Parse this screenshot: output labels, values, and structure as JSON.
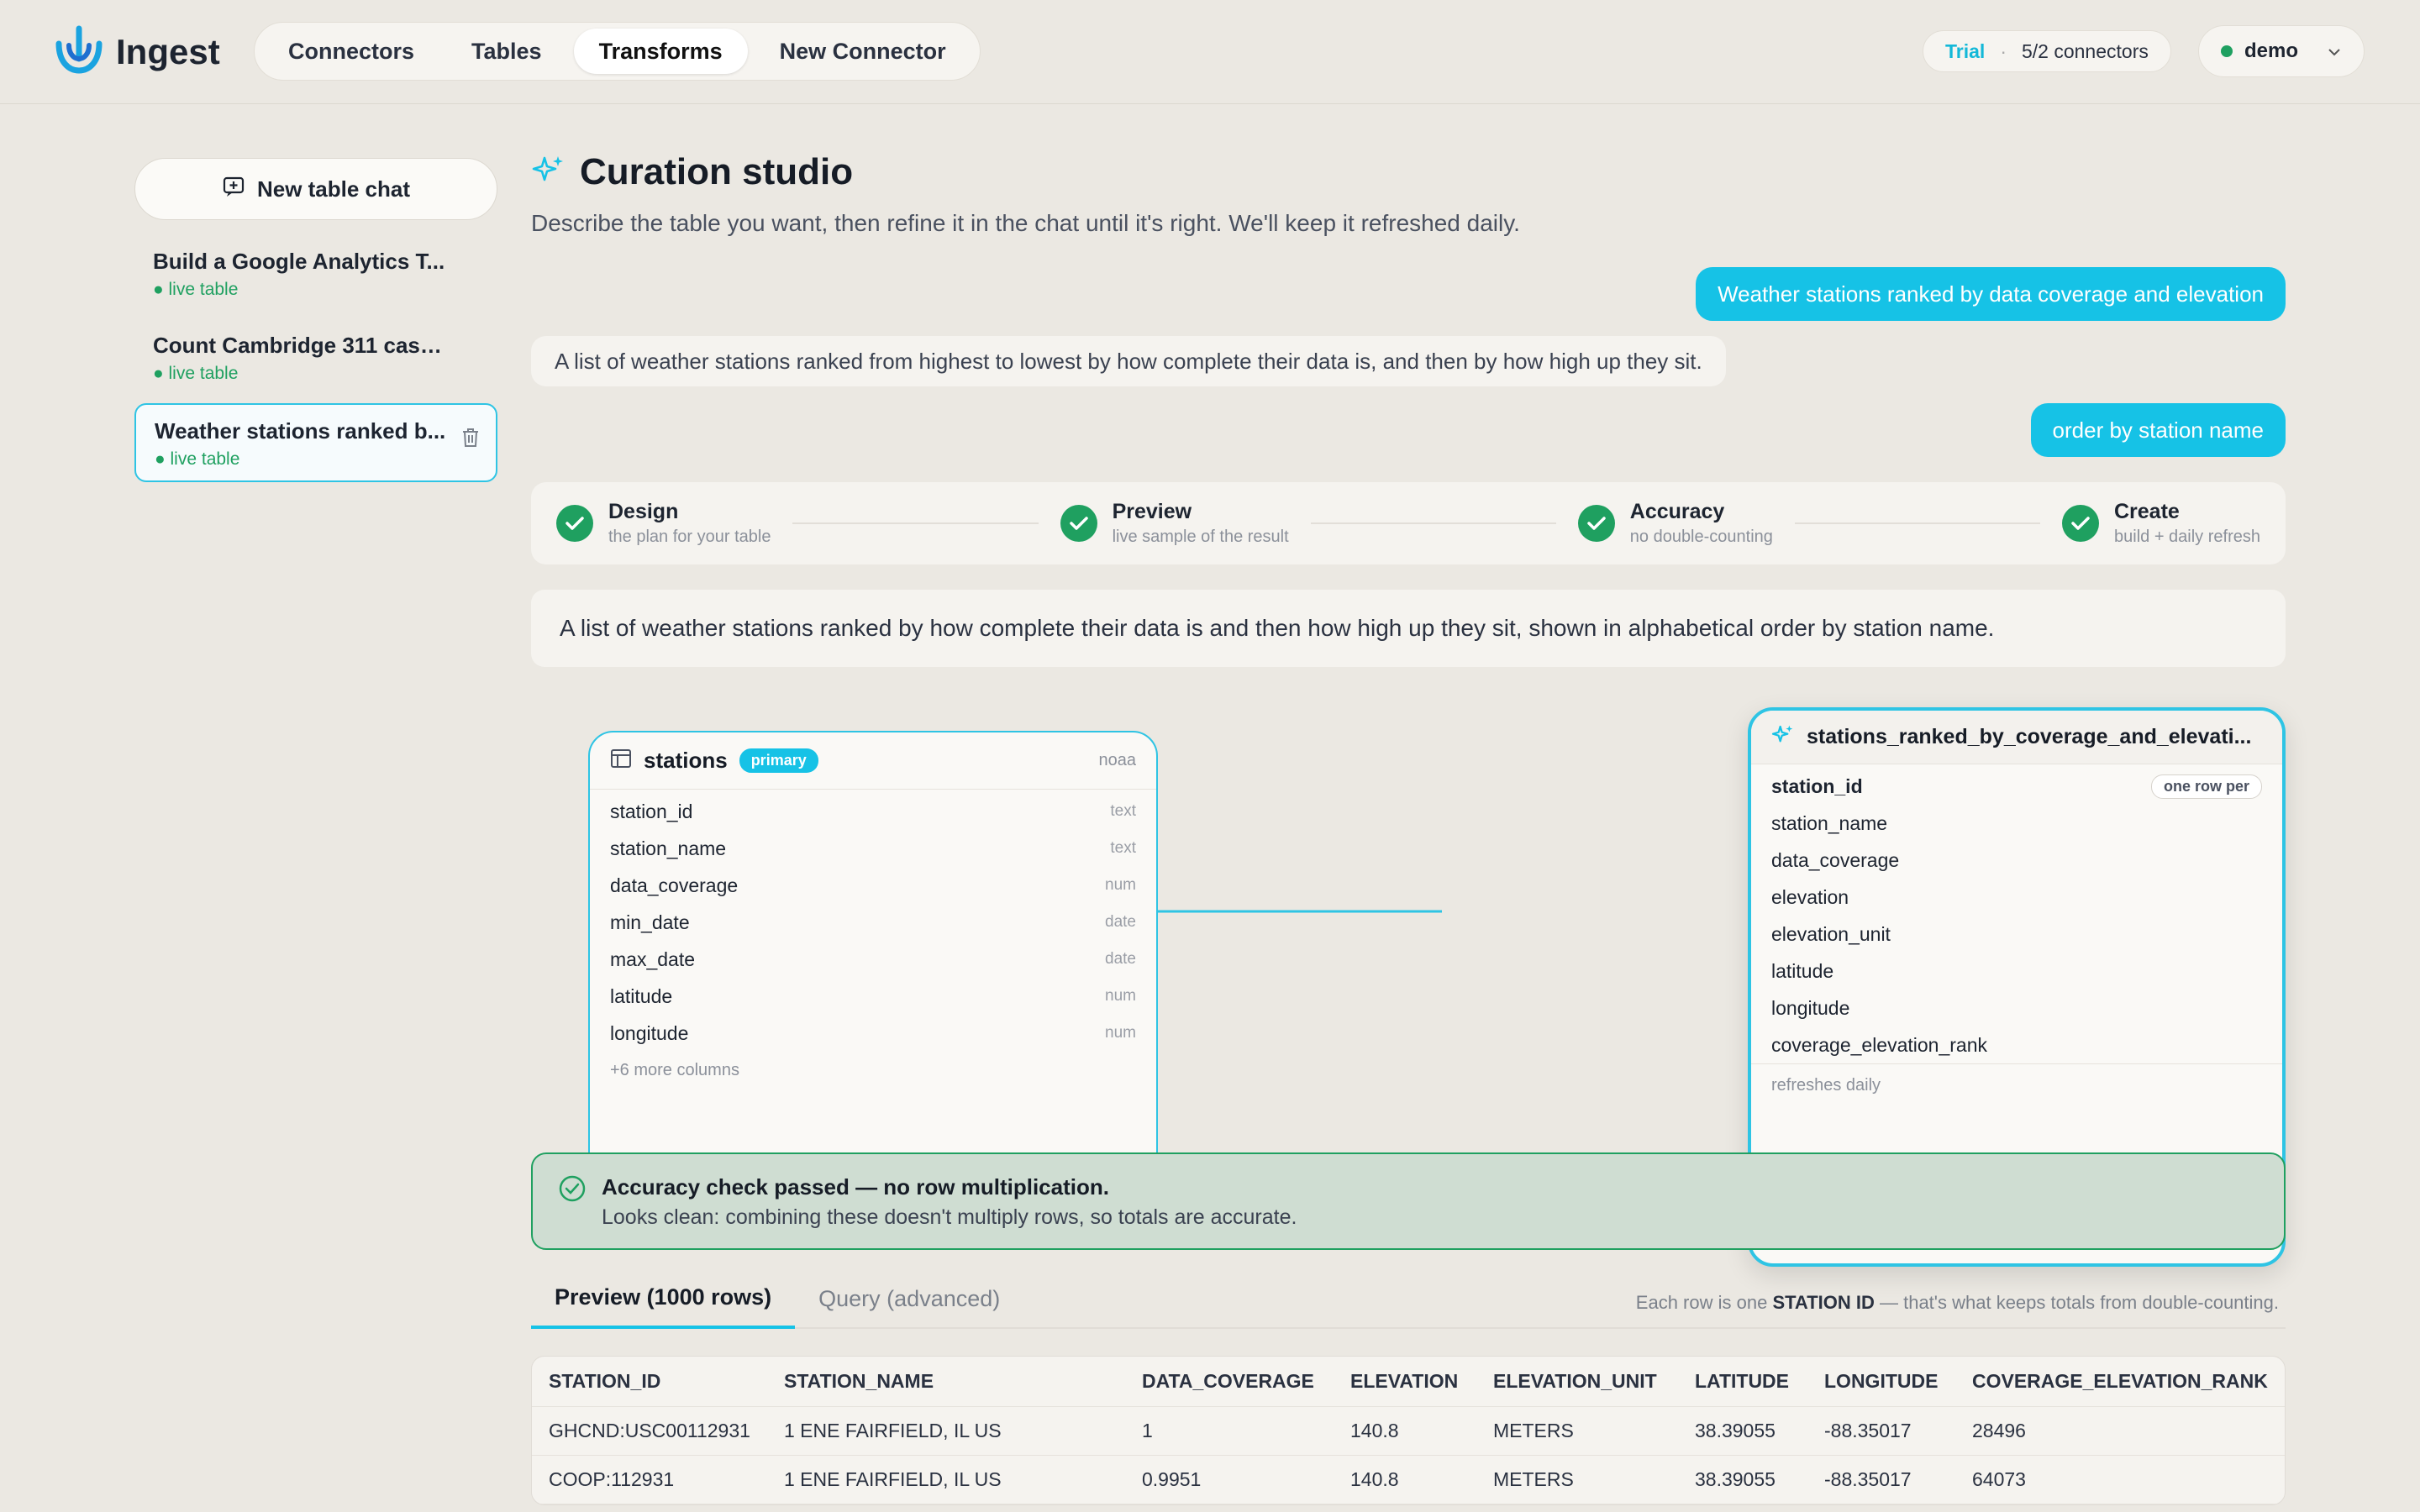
{
  "app": {
    "name": "Ingest"
  },
  "nav": {
    "items": [
      "Connectors",
      "Tables",
      "Transforms",
      "New Connector"
    ],
    "active": "Transforms"
  },
  "trial": {
    "label": "Trial",
    "separator": "·",
    "connectors": "5/2 connectors"
  },
  "user": {
    "name": "demo",
    "status_color": "#1fa060"
  },
  "sidebar": {
    "new_chat_label": "New table chat",
    "chats": [
      {
        "title": "Build a Google Analytics T...",
        "status": "● live table"
      },
      {
        "title": "Count Cambridge 311 case...",
        "status": "● live table"
      },
      {
        "title": "Weather stations ranked b...",
        "status": "● live table"
      }
    ]
  },
  "studio": {
    "title": "Curation studio",
    "subtitle": "Describe the table you want, then refine it in the chat until it's right. We'll keep it refreshed daily."
  },
  "messages": [
    {
      "role": "user",
      "text": "Weather stations ranked by data coverage and elevation"
    },
    {
      "role": "assistant",
      "text": "A list of weather stations ranked from highest to lowest by how complete their data is, and then by how high up they sit."
    },
    {
      "role": "user",
      "text": "order by station name"
    }
  ],
  "steps": [
    {
      "title": "Design",
      "subtitle": "the plan for your table"
    },
    {
      "title": "Preview",
      "subtitle": "live sample of the result"
    },
    {
      "title": "Accuracy",
      "subtitle": "no double-counting"
    },
    {
      "title": "Create",
      "subtitle": "build + daily refresh"
    }
  ],
  "summary": "A list of weather stations ranked by how complete their data is and then how high up they sit, shown in alphabetical order by station name.",
  "source_table": {
    "name": "stations",
    "badge": "primary",
    "source": "noaa",
    "columns": [
      {
        "name": "station_id",
        "type": "text"
      },
      {
        "name": "station_name",
        "type": "text"
      },
      {
        "name": "data_coverage",
        "type": "num"
      },
      {
        "name": "min_date",
        "type": "date"
      },
      {
        "name": "max_date",
        "type": "date"
      },
      {
        "name": "latitude",
        "type": "num"
      },
      {
        "name": "longitude",
        "type": "num"
      }
    ],
    "more": "+6 more columns"
  },
  "output_table": {
    "name": "stations_ranked_by_coverage_and_elevati...",
    "key_pill": "one row per",
    "columns": [
      "station_id",
      "station_name",
      "data_coverage",
      "elevation",
      "elevation_unit",
      "latitude",
      "longitude",
      "coverage_elevation_rank"
    ],
    "footer": "refreshes daily"
  },
  "accuracy": {
    "title": "Accuracy check passed — no row multiplication.",
    "detail": "Looks clean: combining these doesn't multiply rows, so totals are accurate."
  },
  "tabs": {
    "items": [
      "Preview (1000 rows)",
      "Query (advanced)"
    ],
    "note_prefix": "Each row is one",
    "note_key": "STATION ID",
    "note_suffix": "— that's what keeps totals from double-counting."
  },
  "preview": {
    "headers": [
      "STATION_ID",
      "STATION_NAME",
      "DATA_COVERAGE",
      "ELEVATION",
      "ELEVATION_UNIT",
      "LATITUDE",
      "LONGITUDE",
      "COVERAGE_ELEVATION_RANK"
    ],
    "rows": [
      [
        "GHCND:USC00112931",
        "1 ENE FAIRFIELD, IL US",
        "1",
        "140.8",
        "METERS",
        "38.39055",
        "-88.35017",
        "28496"
      ],
      [
        "COOP:112931",
        "1 ENE FAIRFIELD, IL US",
        "0.9951",
        "140.8",
        "METERS",
        "38.39055",
        "-88.35017",
        "64073"
      ]
    ]
  },
  "colors": {
    "accent": "#16c2e6",
    "success": "#1fa060",
    "background": "#ebe8e2"
  }
}
